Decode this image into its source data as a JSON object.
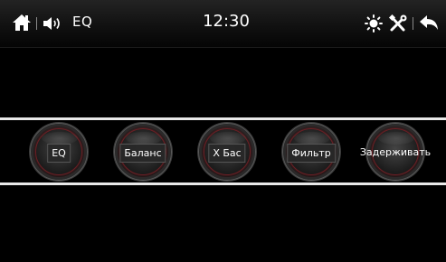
{
  "status_bar": {
    "screen_title": "EQ",
    "time": "12:30",
    "icons": {
      "home": "home-icon",
      "volume": "volume-icon",
      "brightness": "brightness-icon",
      "settings": "tools-icon",
      "back": "back-icon"
    }
  },
  "eq_buttons": [
    {
      "label": "EQ"
    },
    {
      "label": "Баланс"
    },
    {
      "label": "X Бас"
    },
    {
      "label": "Фильтр"
    },
    {
      "label": "Задерживать"
    }
  ],
  "colors": {
    "background": "#000000",
    "rule": "#e9e9e9",
    "knob_ring": "#6b1f24"
  }
}
